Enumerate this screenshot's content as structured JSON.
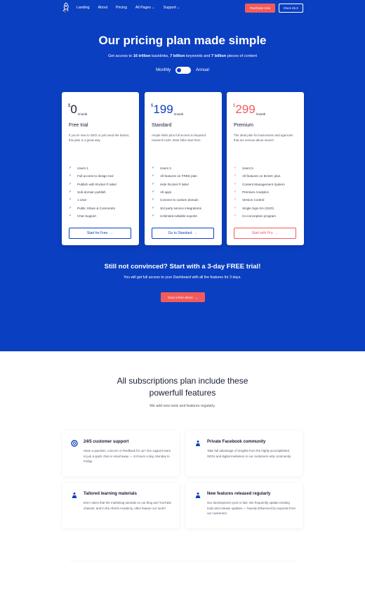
{
  "nav": {
    "links": [
      "Landing",
      "About",
      "Pricing",
      "All Pages",
      "Support"
    ],
    "purchase_label": "Purchase now",
    "docs_label": "Docs v5.3"
  },
  "hero": {
    "title": "Our pricing plan made simple",
    "subtitle_pre": "Get access to ",
    "subtitle_b1": "16 trillion",
    "subtitle_mid1": " backlinks, ",
    "subtitle_b2": "7 billion",
    "subtitle_mid2": " keywords and ",
    "subtitle_b3": "7 billion",
    "subtitle_post": " pieces of content",
    "toggle_monthly": "Monthly",
    "toggle_annual": "Annual"
  },
  "plans": [
    {
      "currency": "$",
      "amount": "0",
      "period": "/month",
      "name": "Free trial",
      "desc": "If you're new to SEO or just need the basics, this plan is a great way.",
      "features": [
        "Users 1",
        "Full access to design tool",
        "Publish with Rocket ® label",
        "Sub-domain publish",
        "1 User",
        "Public Share & Comments",
        "Chat Support"
      ],
      "cta": "Start for Free"
    },
    {
      "currency": "$",
      "amount": "199",
      "period": "/month",
      "name": "Standard",
      "desc": "Ample limits plus full access to keyword research tools. Most folks start here.",
      "features": [
        "Users 3",
        "All features on FREE plan",
        "Hide Rocket ® label",
        "All apps",
        "Connect to custom domain",
        "3rd party service integrations",
        "Unlimited editable exports"
      ],
      "cta": "Go to Standard"
    },
    {
      "currency": "$",
      "amount": "299",
      "period": "/month",
      "name": "Premium",
      "desc": "The ideal plan for businesses and agencies that are serious about search.",
      "features": [
        "Users 5",
        "All features on BASIC plan",
        "Content Management System",
        "Premium Analytics",
        "Version Control",
        "Single Sign-On (SSO)",
        "Co-conception program"
      ],
      "cta": "Start with Pro"
    }
  ],
  "trial": {
    "title": "Still not convinced? Start with a 3-day FREE trial!",
    "subtitle": "You will get full access to your Dashboard with all the features for 3 days.",
    "button": "Start a free demo"
  },
  "features_section": {
    "title_line1": "All subscriptions plan include these",
    "title_line2": "powerfull features",
    "subtitle": "We add new tools and features regularly.",
    "items": [
      {
        "title": "24/5 customer support",
        "desc": "Have a question, concern or feedback for us? Our support team is just a quick chat or email away — 24 hours a day, Monday to Friday."
      },
      {
        "title": "Private Facebook community",
        "desc": "Take full advantage of insights from the highly accomplished SEOs and digital marketers in our customers-only community."
      },
      {
        "title": "Tailored learning materials",
        "desc": "Ever notice that the marketing tutorials on our blog and YouTube channel, and in the Ahrefs Academy, often feature our tools?"
      },
      {
        "title": "New features released regularly",
        "desc": "Our development cycle is fast. We frequently update existing tools and release updates — heavily influenced by requests from our customers."
      }
    ]
  },
  "colors": {
    "brand": "#0b3fc1",
    "accent": "#f35b5b"
  }
}
